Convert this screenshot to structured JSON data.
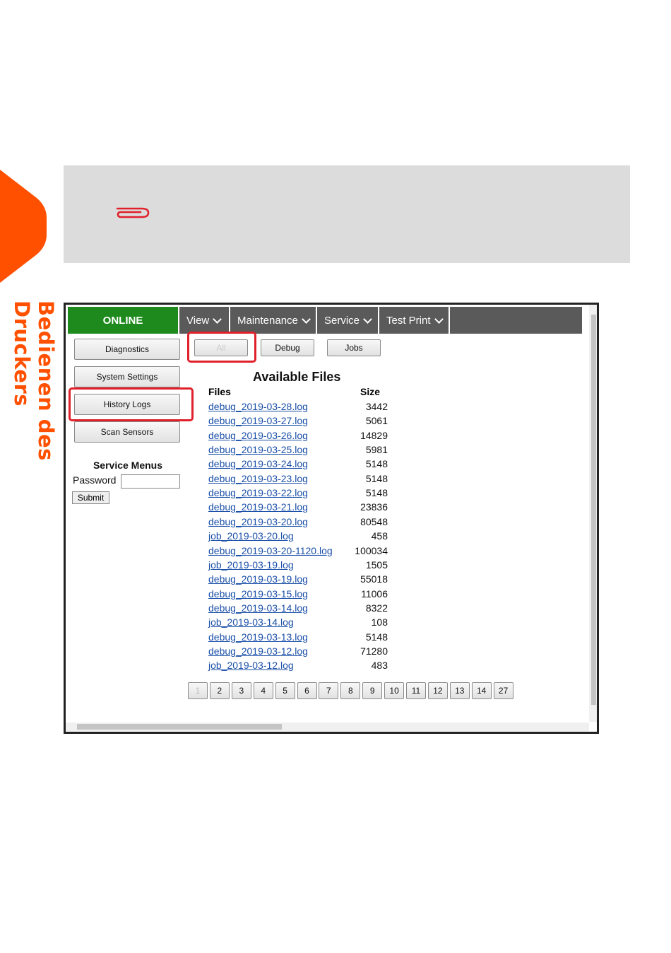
{
  "page": {
    "side_title": "Bedienen des Druckers",
    "accent_color": "#ff5000",
    "note_icon": "paperclip-icon"
  },
  "ui": {
    "nav": {
      "status": "ONLINE",
      "items": [
        {
          "label": "View"
        },
        {
          "label": "Maintenance"
        },
        {
          "label": "Service"
        },
        {
          "label": "Test Print"
        }
      ]
    },
    "sidebar": {
      "buttons": [
        "Diagnostics",
        "System Settings",
        "History Logs",
        "Scan Sensors"
      ],
      "service_menus_title": "Service Menus",
      "password_label": "Password",
      "password_value": "",
      "submit_label": "Submit"
    },
    "filter_buttons": [
      "All",
      "Debug",
      "Jobs"
    ],
    "files_title": "Available Files",
    "col_files": "Files",
    "col_size": "Size",
    "files": [
      {
        "name": "debug_2019-03-28.log",
        "size": "3442"
      },
      {
        "name": "debug_2019-03-27.log",
        "size": "5061"
      },
      {
        "name": "debug_2019-03-26.log",
        "size": "14829"
      },
      {
        "name": "debug_2019-03-25.log",
        "size": "5981"
      },
      {
        "name": "debug_2019-03-24.log",
        "size": "5148"
      },
      {
        "name": "debug_2019-03-23.log",
        "size": "5148"
      },
      {
        "name": "debug_2019-03-22.log",
        "size": "5148"
      },
      {
        "name": "debug_2019-03-21.log",
        "size": "23836"
      },
      {
        "name": "debug_2019-03-20.log",
        "size": "80548"
      },
      {
        "name": "job_2019-03-20.log",
        "size": "458"
      },
      {
        "name": "debug_2019-03-20-1120.log",
        "size": "100034"
      },
      {
        "name": "job_2019-03-19.log",
        "size": "1505"
      },
      {
        "name": "debug_2019-03-19.log",
        "size": "55018"
      },
      {
        "name": "debug_2019-03-15.log",
        "size": "11006"
      },
      {
        "name": "debug_2019-03-14.log",
        "size": "8322"
      },
      {
        "name": "job_2019-03-14.log",
        "size": "108"
      },
      {
        "name": "debug_2019-03-13.log",
        "size": "5148"
      },
      {
        "name": "debug_2019-03-12.log",
        "size": "71280"
      },
      {
        "name": "job_2019-03-12.log",
        "size": "483"
      }
    ],
    "pages": [
      "1",
      "2",
      "3",
      "4",
      "5",
      "6",
      "7",
      "8",
      "9",
      "10",
      "11",
      "12",
      "13",
      "14",
      "27"
    ],
    "highlight_color": "#e0202a"
  }
}
